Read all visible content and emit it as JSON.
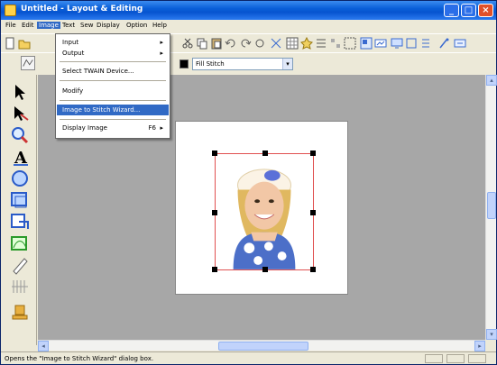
{
  "window": {
    "title": "Untitled - Layout & Editing"
  },
  "menubar": {
    "items": [
      "File",
      "Edit",
      "Image",
      "Text",
      "Sew",
      "Display",
      "Option",
      "Help"
    ],
    "active_index": 2
  },
  "toolbar": {
    "stitch_select_value": "Fill Stitch",
    "stitch_select_arrow": "▾",
    "color": "#000000"
  },
  "image_menu": {
    "items": [
      {
        "label": "Input",
        "submenu": "▸"
      },
      {
        "label": "Output",
        "submenu": "▸"
      },
      {
        "label": "Select TWAIN Device..."
      },
      {
        "label": "Modify"
      },
      {
        "label": "Image to Stitch Wizard..."
      },
      {
        "label": "Display Image",
        "shortcut": "F6",
        "submenu": "▸"
      }
    ],
    "selected_index": 4
  },
  "statusbar": {
    "text": "Opens the \"Image to Stitch Wizard\" dialog box."
  },
  "scroll": {
    "left_arrow": "◂",
    "right_arrow": "▸",
    "up_arrow": "▴",
    "down_arrow": "▾"
  },
  "titlebar_buttons": {
    "minimize": "_",
    "maximize": "□",
    "close": "×"
  },
  "colors": {
    "title_blue": "#0a5fd8",
    "menu_highlight": "#316ac5",
    "frame_red": "#e05050",
    "canvas_gray": "#a7a7a7"
  }
}
